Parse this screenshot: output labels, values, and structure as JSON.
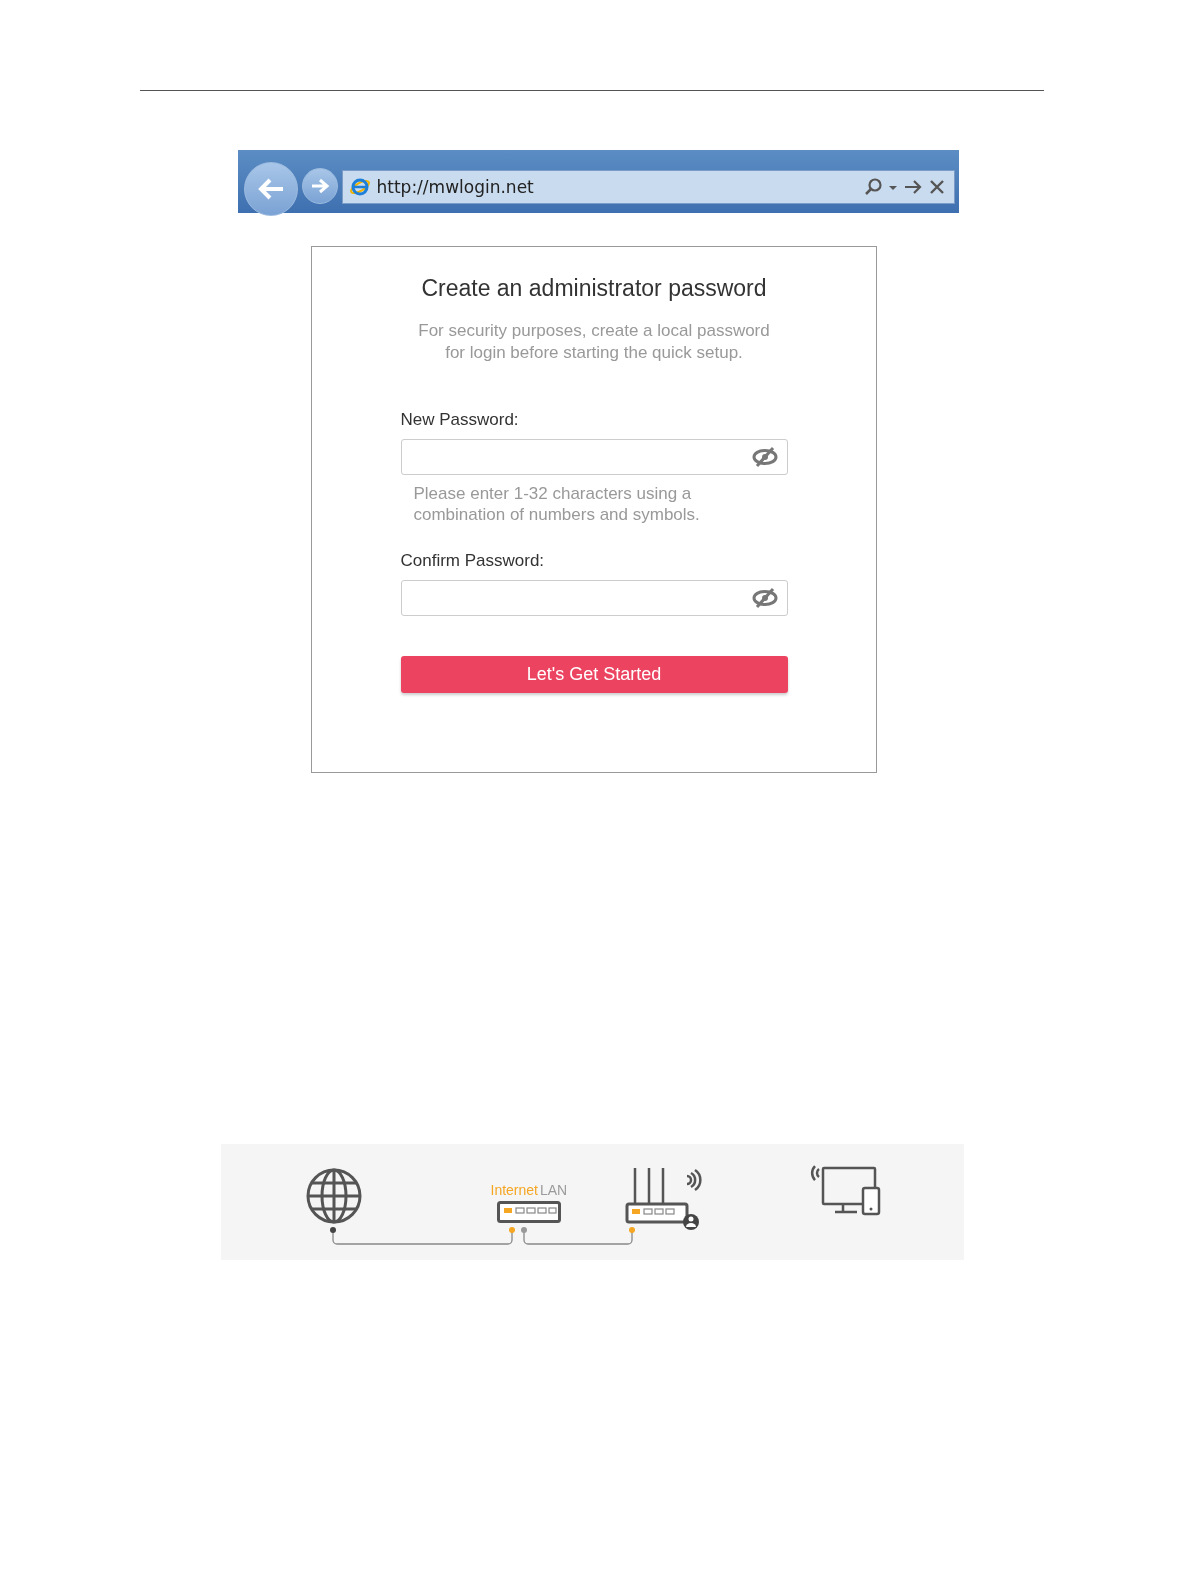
{
  "browser": {
    "address": "http://mwlogin.net"
  },
  "form": {
    "title": "Create an administrator password",
    "subtitle": "For security purposes, create a local password for login before starting the quick setup.",
    "fields": [
      {
        "label": "New Password:",
        "hint": "Please enter 1-32 characters using a combination of numbers and symbols."
      },
      {
        "label": "Confirm Password:"
      }
    ],
    "button": "Let's Get Started"
  },
  "diagram": {
    "port_labels": [
      {
        "text": "Internet",
        "color": "#f5a623"
      },
      {
        "text": "LAN",
        "color": "#9b9b9b"
      }
    ]
  }
}
